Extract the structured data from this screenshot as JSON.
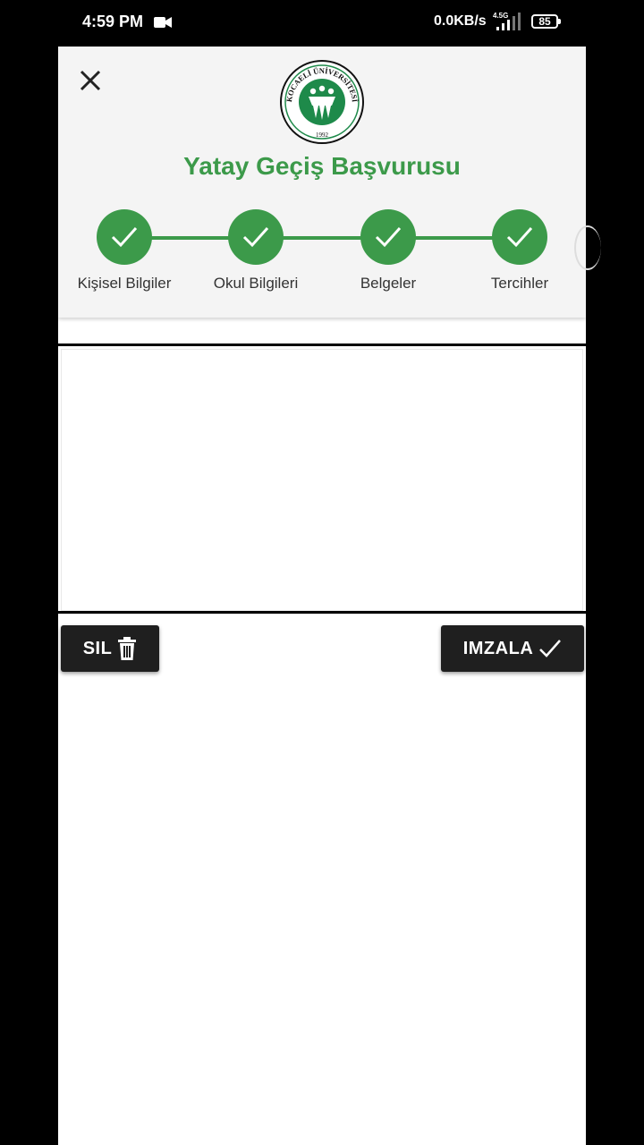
{
  "status_bar": {
    "time": "4:59 PM",
    "speed": "0.0KB/s",
    "network": "4.5G",
    "battery": "85"
  },
  "header": {
    "title": "Yatay Geçiş Başvurusu",
    "logo_text_top": "KOCAELİ ÜNİVERSİTESİ",
    "logo_year": "1992"
  },
  "steps": [
    {
      "label": "Kişisel Bilgiler",
      "status": "complete"
    },
    {
      "label": "Okul Bilgileri",
      "status": "complete"
    },
    {
      "label": "Belgeler",
      "status": "complete"
    },
    {
      "label": "Tercihler",
      "status": "complete"
    }
  ],
  "actions": {
    "clear_label": "SIL",
    "sign_label": "IMZALA"
  },
  "colors": {
    "accent": "#3c9a4a",
    "button_bg": "#1f1f1f"
  }
}
